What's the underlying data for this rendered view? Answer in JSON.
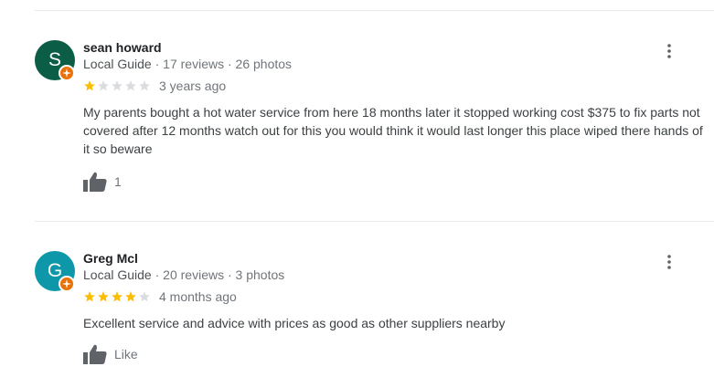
{
  "reviews": [
    {
      "avatar_letter": "S",
      "avatar_color": "#0b5e45",
      "name": "sean howard",
      "guide_label": "Local Guide",
      "reviews_count": "17 reviews",
      "photos_count": "26 photos",
      "rating": 1,
      "date": "3 years ago",
      "text": "My parents bought a hot water service from here 18 months later it stopped working cost $375 to fix parts not covered after 12 months watch out for this  you would think it would last longer this place wiped there hands of it so beware",
      "likes": "1"
    },
    {
      "avatar_letter": "G",
      "avatar_color": "#0e97a8",
      "name": "Greg Mcl",
      "guide_label": "Local Guide",
      "reviews_count": "20 reviews",
      "photos_count": "3 photos",
      "rating": 4,
      "date": "4 months ago",
      "text": "Excellent service and advice with prices as good as other suppliers nearby",
      "likes": "Like"
    }
  ],
  "separator": "·",
  "colors": {
    "star_filled": "#fbbc04",
    "star_empty": "#dadce0",
    "badge": "#e8710a"
  },
  "icons": [
    "local-guide-badge-icon",
    "star-icon",
    "thumbs-up-icon",
    "more-vert-icon"
  ]
}
